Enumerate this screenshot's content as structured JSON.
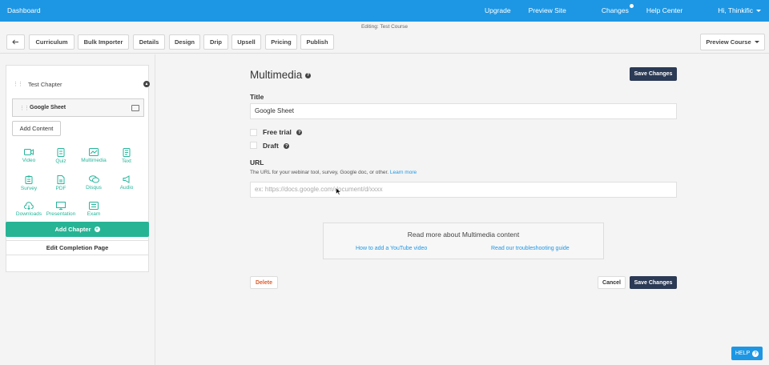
{
  "topbar": {
    "brand": "Dashboard",
    "nav": [
      "Upgrade",
      "Preview Site",
      "Changes",
      "Help Center",
      "Hi, Thinkific"
    ]
  },
  "editing": "Editing: Test Course",
  "toolbar": {
    "back_icon": "arrow-left-icon",
    "tabs": [
      "Curriculum",
      "Bulk Importer",
      "Details",
      "Design",
      "Drip",
      "Upsell",
      "Pricing",
      "Publish"
    ],
    "preview": "Preview Course"
  },
  "sidebar": {
    "chapter_title": "Test Chapter",
    "lesson": "Google Sheet",
    "add_content": "Add Content",
    "content_types": [
      {
        "label": "Video",
        "icon": "video-icon"
      },
      {
        "label": "Quiz",
        "icon": "quiz-icon"
      },
      {
        "label": "Multimedia",
        "icon": "multimedia-icon"
      },
      {
        "label": "Text",
        "icon": "text-icon"
      },
      {
        "label": "Survey",
        "icon": "survey-icon"
      },
      {
        "label": "PDF",
        "icon": "pdf-icon"
      },
      {
        "label": "Disqus",
        "icon": "disqus-icon"
      },
      {
        "label": "Audio",
        "icon": "audio-icon"
      },
      {
        "label": "Downloads",
        "icon": "downloads-icon"
      },
      {
        "label": "Presentation",
        "icon": "presentation-icon"
      },
      {
        "label": "Exam",
        "icon": "exam-icon"
      }
    ],
    "add_chapter": "Add Chapter",
    "edit_completion": "Edit Completion Page"
  },
  "main": {
    "title": "Multimedia",
    "save_changes": "Save Changes",
    "title_label": "Title",
    "title_value": "Google Sheet",
    "free_trial": "Free trial",
    "draft": "Draft",
    "url_label": "URL",
    "url_help": "The URL for your webinar tool, survey, Google doc, or other.",
    "learn_more": "Learn more",
    "url_placeholder": "ex: https://docs.google.com/document/d/xxxx",
    "read_more_title": "Read more about Multimedia content",
    "link_youtube": "How to add a YouTube video",
    "link_troubleshoot": "Read our troubleshooting guide",
    "delete": "Delete",
    "cancel": "Cancel"
  },
  "help_button": "HELP",
  "colors": {
    "topbar": "#1d97e4",
    "accent_green": "#27b495",
    "dark_button": "#2b3a55",
    "delete_text": "#e05b2b"
  }
}
